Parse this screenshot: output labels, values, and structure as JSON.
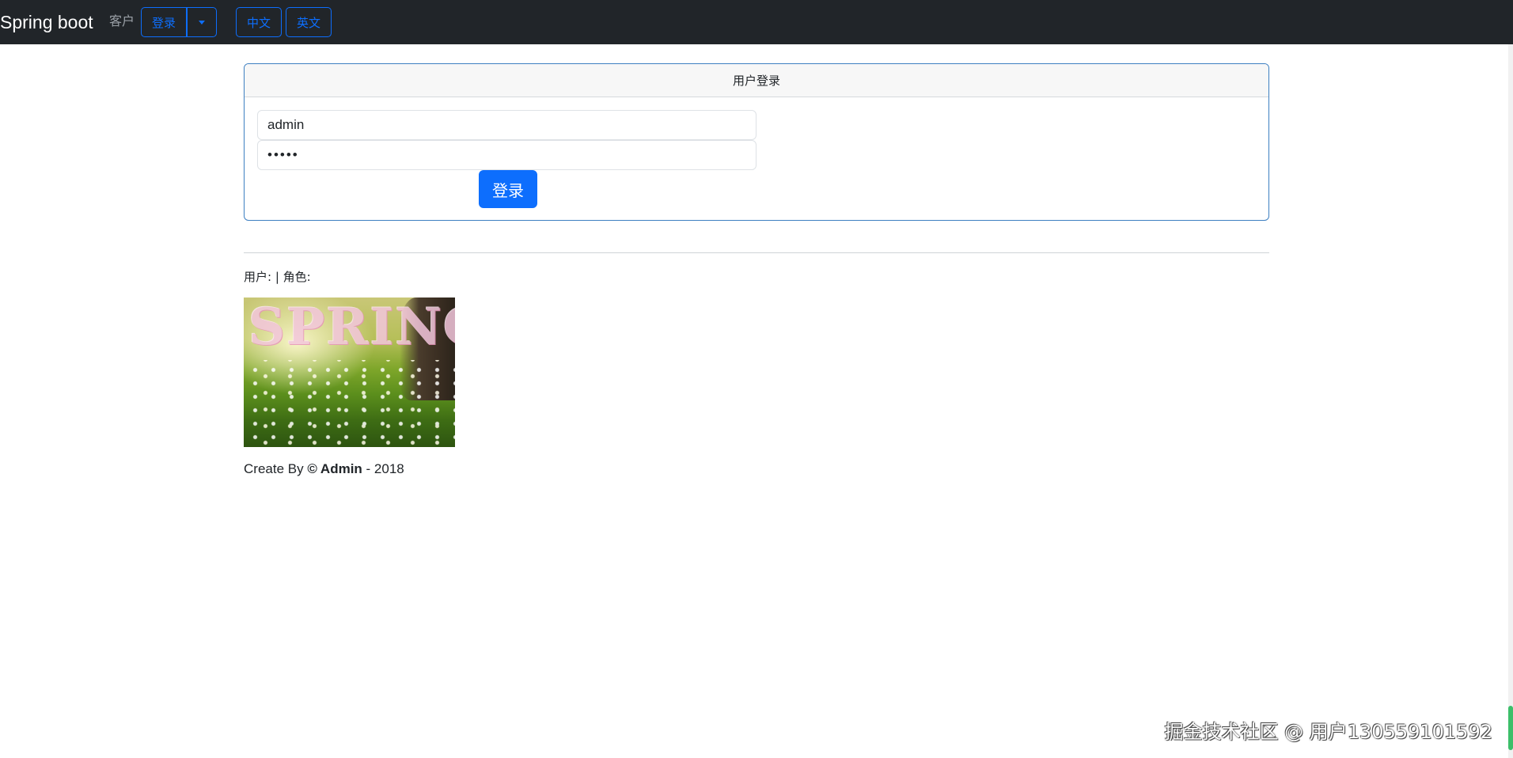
{
  "navbar": {
    "brand": "Spring boot",
    "guest_label": "客户",
    "login_label": "登录",
    "lang_zh": "中文",
    "lang_en": "英文"
  },
  "login_card": {
    "title": "用户登录",
    "username_value": "admin",
    "password_value": "•••••",
    "submit_label": "登录"
  },
  "user_info": {
    "text": "用户: | 角色:"
  },
  "image": {
    "word": "SPRING"
  },
  "footer": {
    "prefix": "Create By ",
    "author": "© Admin",
    "suffix": " - 2018"
  },
  "watermark": {
    "text": "掘金技术社区 @ 用户130559101592"
  },
  "colors": {
    "navbar_bg": "#212529",
    "primary": "#0d6efd",
    "card_border": "#3d7fc1"
  }
}
